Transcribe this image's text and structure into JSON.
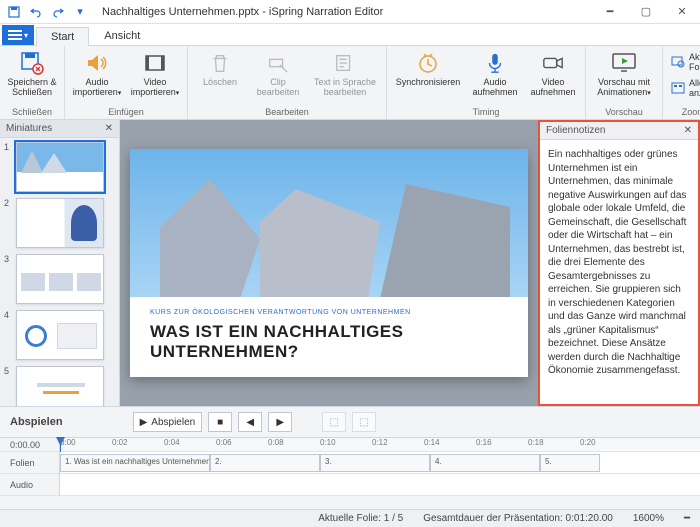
{
  "title": "Nachhaltiges Unternehmen.pptx - iSpring Narration Editor",
  "tabs": {
    "start": "Start",
    "view": "Ansicht"
  },
  "ribbon": {
    "save_close": "Speichern\n& Schließen",
    "audio_import": "Audio\nimportieren",
    "video_import": "Video\nimportieren",
    "delete": "Löschen",
    "clip_edit": "Clip\nbearbeiten",
    "tts": "Text in Sprache\nbearbeiten",
    "sync": "Synchronisieren",
    "rec_audio": "Audio\naufnehmen",
    "rec_video": "Video\naufnehmen",
    "preview": "Vorschau mit\nAnimationen",
    "current_slide": "Aktuelle Folie",
    "show_all": "Alles anzeigen",
    "g_close": "Schließen",
    "g_insert": "Einfügen",
    "g_edit": "Bearbeiten",
    "g_timing": "Timing",
    "g_preview": "Vorschau",
    "g_zoom": "Zoomen"
  },
  "miniatures": {
    "title": "Miniatures"
  },
  "slide": {
    "overline": "KURS ZUR ÖKOLOGISCHEN VERANTWORTUNG VON UNTERNEHMEN",
    "title": "WAS IST EIN NACHHALTIGES UNTERNEHMEN?"
  },
  "notes": {
    "title": "Foliennotizen",
    "body": "Ein nachhaltiges oder grünes Unternehmen ist ein Unternehmen, das minimale negative Auswirkungen auf das globale oder lokale Umfeld, die Gemeinschaft, die Gesellschaft oder die Wirtschaft hat – ein Unternehmen, das bestrebt ist, die drei Elemente des Gesamtergebnisses zu erreichen. Sie gruppieren sich in verschiedenen Kategorien und das Ganze wird manchmal als „grüner Kapitalismus“ bezeichnet. Diese Ansätze werden durch die Nachhaltige Ökonomie zusammengefasst."
  },
  "timeline": {
    "title": "Abspielen",
    "play": "Abspielen",
    "row_time": "0:00.00",
    "row_slides": "Folien",
    "row_audio": "Audio",
    "clip1": "1. Was ist ein nachhaltiges Unternehmen?",
    "marks": [
      "0:00",
      "0:02",
      "0:04",
      "0:06",
      "0:08",
      "0:10",
      "0:12",
      "0:14",
      "0:16",
      "0:18",
      "0:20"
    ]
  },
  "status": {
    "slide": "Aktuelle Folie: 1 / 5",
    "duration": "Gesamtdauer der Präsentation: 0:01:20.00",
    "zoom": "1600%"
  }
}
